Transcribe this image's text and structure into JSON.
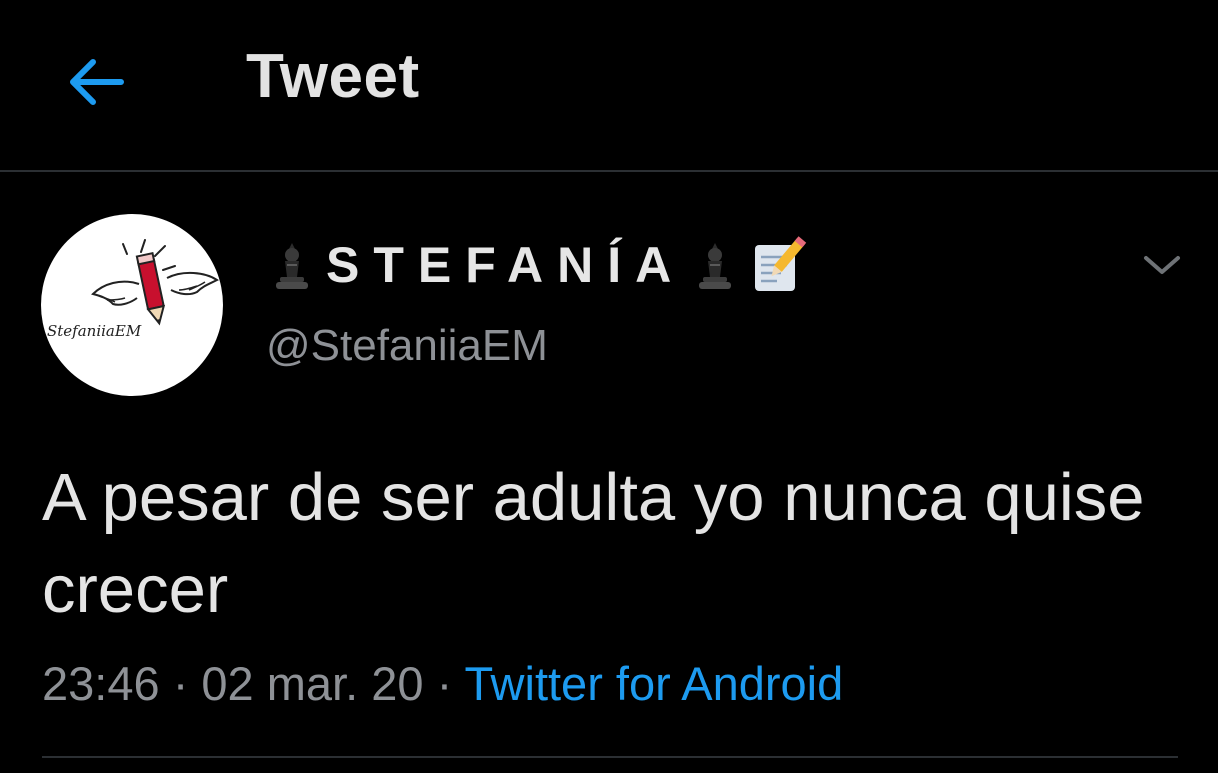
{
  "header": {
    "title": "Tweet",
    "back_icon": "arrow-left-icon"
  },
  "tweet": {
    "author": {
      "display_name": "STEFANÍA",
      "handle": "@StefaniiaEM",
      "name_prefix_icon": "chess-piece-icon",
      "name_suffix_icons": [
        "chess-piece-icon",
        "memo-icon"
      ],
      "avatar_text": "StefaniiaEM"
    },
    "text": "A pesar de ser adulta yo nunca quise crecer",
    "time": "23:46",
    "separator": "·",
    "date": "02 mar. 20",
    "source": "Twitter for Android",
    "menu_icon": "chevron-down-icon"
  },
  "colors": {
    "background": "#000000",
    "link": "#1d9bf0",
    "secondary_text": "#8e9196",
    "divider": "#2b2f33"
  }
}
